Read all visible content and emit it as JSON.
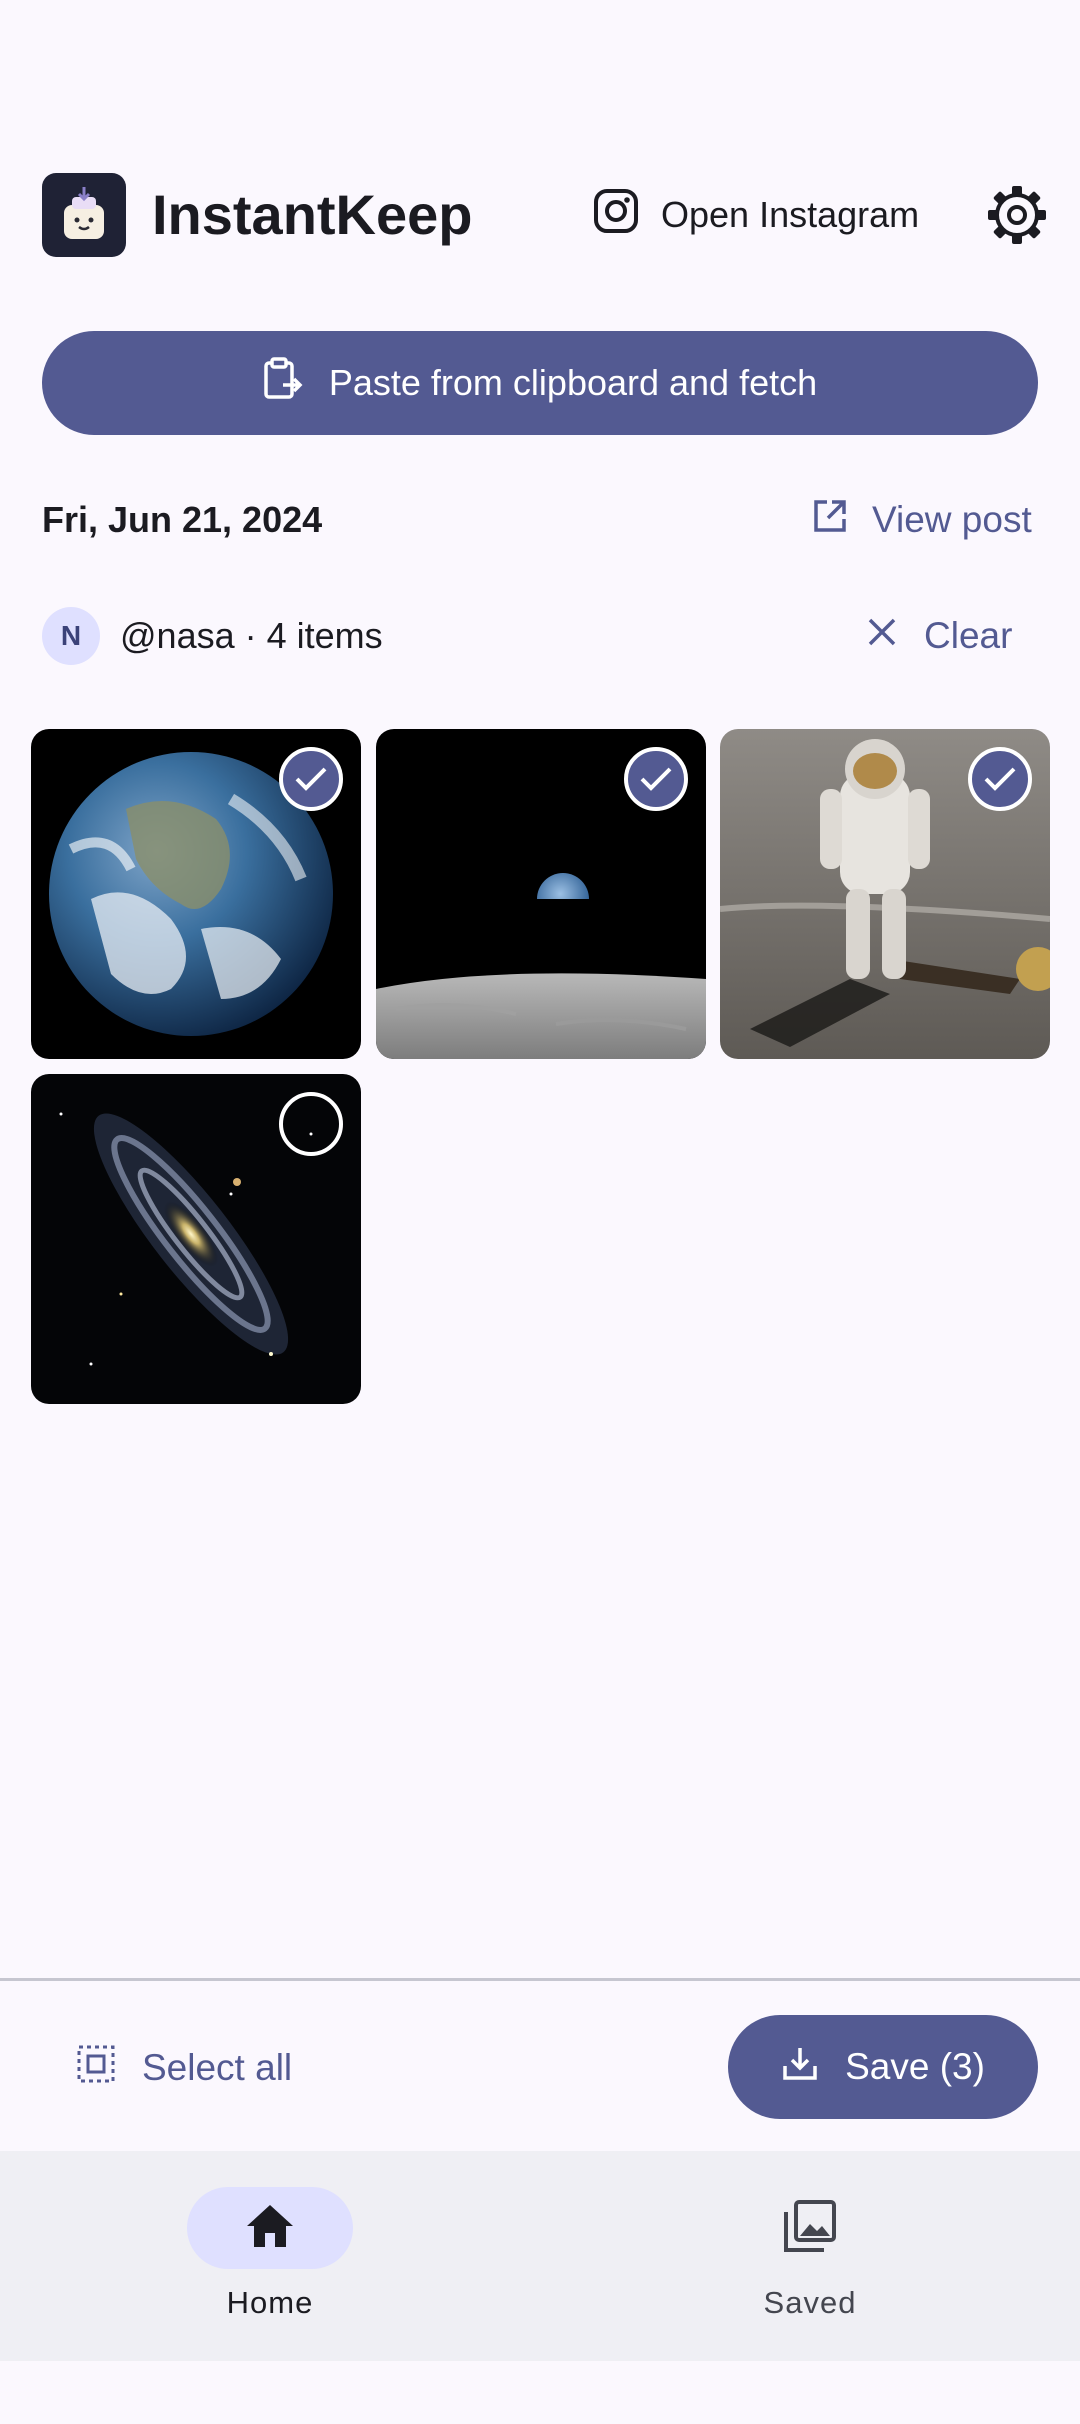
{
  "header": {
    "app_name": "InstantKeep",
    "open_instagram_label": "Open Instagram"
  },
  "actions": {
    "paste_label": "Paste from clipboard and fetch"
  },
  "post": {
    "date": "Fri, Jun 21, 2024",
    "view_post_label": "View post",
    "avatar_initial": "N",
    "meta": "@nasa · 4 items",
    "clear_label": "Clear"
  },
  "grid": {
    "items": [
      {
        "name": "earth-photo",
        "selected": true
      },
      {
        "name": "earthrise-photo",
        "selected": true
      },
      {
        "name": "astronaut-photo",
        "selected": true
      },
      {
        "name": "galaxy-photo",
        "selected": false
      }
    ]
  },
  "footer": {
    "select_all_label": "Select all",
    "save_label": "Save (3)"
  },
  "nav": {
    "items": [
      {
        "label": "Home",
        "icon": "home-icon",
        "active": true
      },
      {
        "label": "Saved",
        "icon": "gallery-icon",
        "active": false
      }
    ]
  },
  "colors": {
    "primary": "#535a92",
    "primary_container": "#dfe0ff",
    "background": "#fbf8fe",
    "nav_background": "#efeff4"
  }
}
